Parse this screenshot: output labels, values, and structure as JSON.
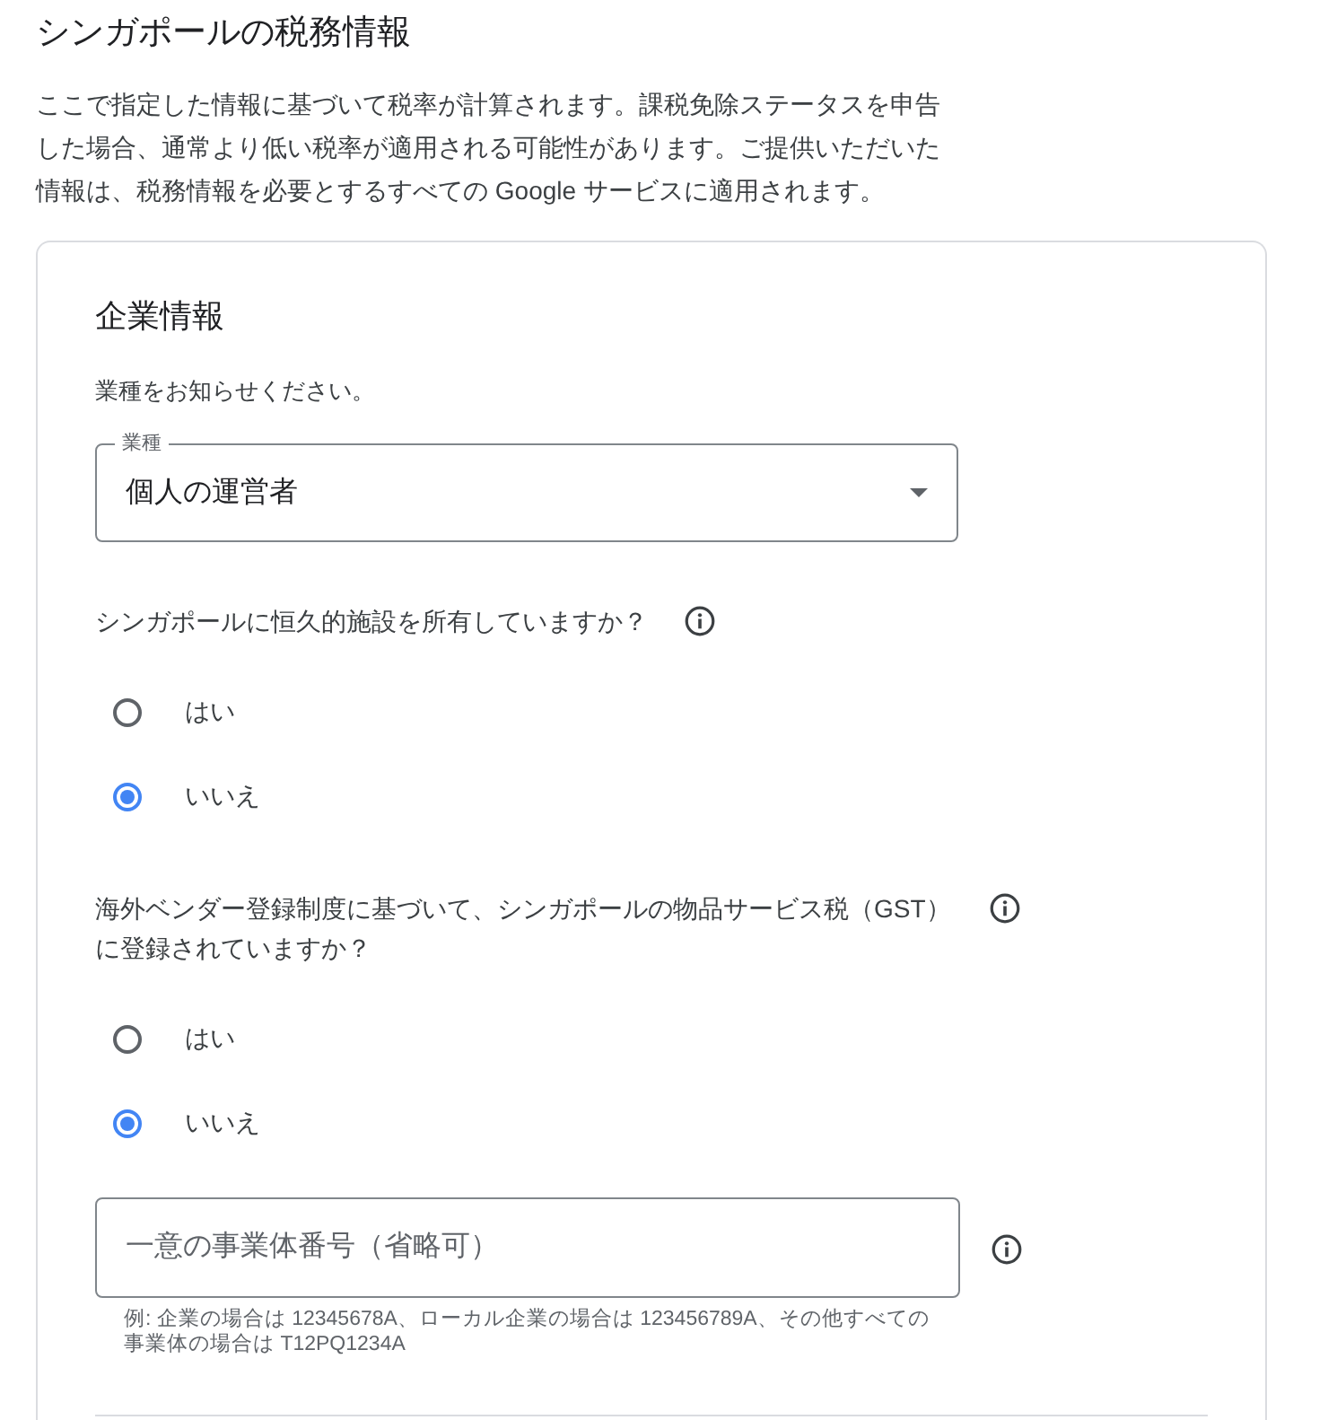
{
  "page": {
    "title": "シンガポールの税務情報",
    "description": "ここで指定した情報に基づいて税率が計算されます。課税免除ステータスを申告した場合、通常より低い税率が適用される可能性があります。ご提供いただいた情報は、税務情報を必要とするすべての Google サービスに適用されます。"
  },
  "section": {
    "heading": "企業情報",
    "prompt": "業種をお知らせください。",
    "business_type": {
      "label": "業種",
      "value": "個人の運営者"
    },
    "questions": [
      {
        "text": "シンガポールに恒久的施設を所有していますか？",
        "options": [
          {
            "label": "はい",
            "selected": false
          },
          {
            "label": "いいえ",
            "selected": true
          }
        ]
      },
      {
        "text": "海外ベンダー登録制度に基づいて、シンガポールの物品サービス税（GST）に登録されていますか？",
        "options": [
          {
            "label": "はい",
            "selected": false
          },
          {
            "label": "いいえ",
            "selected": true
          }
        ]
      }
    ],
    "entity_number": {
      "placeholder": "一意の事業体番号（省略可）",
      "hint": "例: 企業の場合は 12345678A、ローカル企業の場合は 123456789A、その他すべての事業体の場合は T12PQ1234A"
    }
  }
}
